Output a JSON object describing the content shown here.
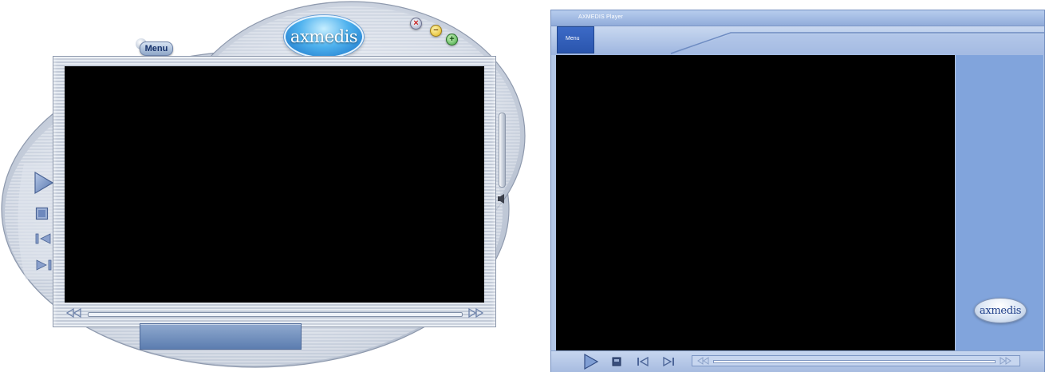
{
  "left_skin": {
    "menu_label": "Menu",
    "logo_text": "axmedis",
    "window_buttons": {
      "close_icon": "close-icon",
      "minimize_icon": "minimize-icon",
      "maximize_icon": "maximize-icon"
    },
    "controls": [
      "play-icon",
      "stop-icon",
      "previous-icon",
      "next-icon"
    ],
    "seek": {
      "rewind_icon": "rewind-icon",
      "forward_icon": "fast-forward-icon"
    },
    "volume_icon": "speaker-icon",
    "colors": {
      "video_bg": "#000000",
      "status_panel": "#6f8dbf",
      "accent": "#3a8fe0"
    }
  },
  "right_skin": {
    "app_title": "AXMEDIS Player",
    "menu_label": "Menu",
    "logo_text": "axmedis",
    "controls": [
      "play-icon",
      "stop-icon",
      "previous-icon",
      "next-icon"
    ],
    "seek": {
      "rewind_icon": "rewind-icon",
      "forward_icon": "fast-forward-icon"
    },
    "colors": {
      "video_bg": "#000000",
      "side_panel": "#81a4dc",
      "menu_tab": "#2f5fb8"
    }
  }
}
